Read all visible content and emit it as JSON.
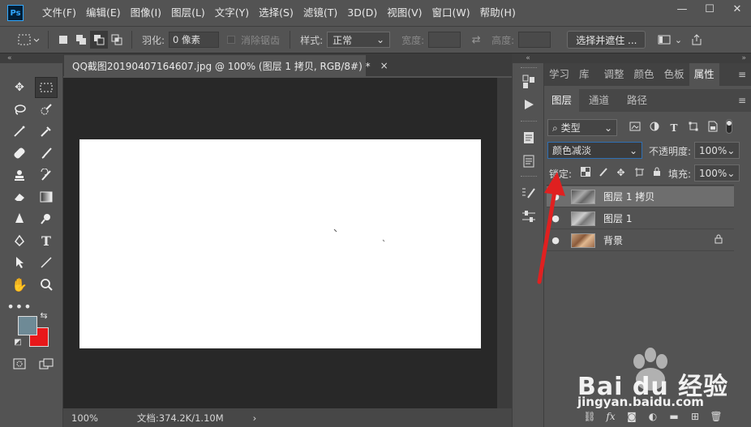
{
  "app": {
    "logo": "Ps"
  },
  "menu": [
    "文件(F)",
    "编辑(E)",
    "图像(I)",
    "图层(L)",
    "文字(Y)",
    "选择(S)",
    "滤镜(T)",
    "3D(D)",
    "视图(V)",
    "窗口(W)",
    "帮助(H)"
  ],
  "window_controls": {
    "minimize": "—",
    "maximize": "☐",
    "close": "✕"
  },
  "options": {
    "feather_label": "羽化:",
    "feather_value": "0 像素",
    "antialias_label": "消除锯齿",
    "style_label": "样式:",
    "style_value": "正常",
    "width_label": "宽度:",
    "height_label": "高度:",
    "select_mask_button": "选择并遮住 ..."
  },
  "document": {
    "tab_title": "QQ截图20190407164607.jpg @ 100% (图层 1 拷贝, RGB/8#) *",
    "close_glyph": "×",
    "zoom": "100%",
    "doc_info": "文档:374.2K/1.10M",
    "status_arrow": "›"
  },
  "panels": {
    "top_tabs": [
      "学习",
      "库",
      "调整",
      "颜色",
      "色板",
      "属性"
    ],
    "active_top_tab": "属性",
    "layer_tabs": [
      "图层",
      "通道",
      "路径"
    ],
    "active_layer_tab": "图层"
  },
  "layers_panel": {
    "filter_kind": "类型",
    "blend_mode": "颜色减淡",
    "opacity_label": "不透明度:",
    "opacity_value": "100%",
    "lock_label": "锁定:",
    "fill_label": "填充:",
    "fill_value": "100%",
    "layers": [
      {
        "name": "图层 1 拷贝",
        "selected": true,
        "thumb_color": "#8a8a8a"
      },
      {
        "name": "图层 1",
        "selected": false,
        "thumb_color": "#9a9a9a"
      },
      {
        "name": "背景",
        "selected": false,
        "thumb_color": "#b88a6a"
      }
    ]
  },
  "colors": {
    "foreground": "#6e8a96",
    "background": "#e8181a",
    "annotation_arrow": "#e02020"
  },
  "watermark": {
    "text": "Bai du 经验",
    "sub": "jingyan.baidu.com"
  }
}
